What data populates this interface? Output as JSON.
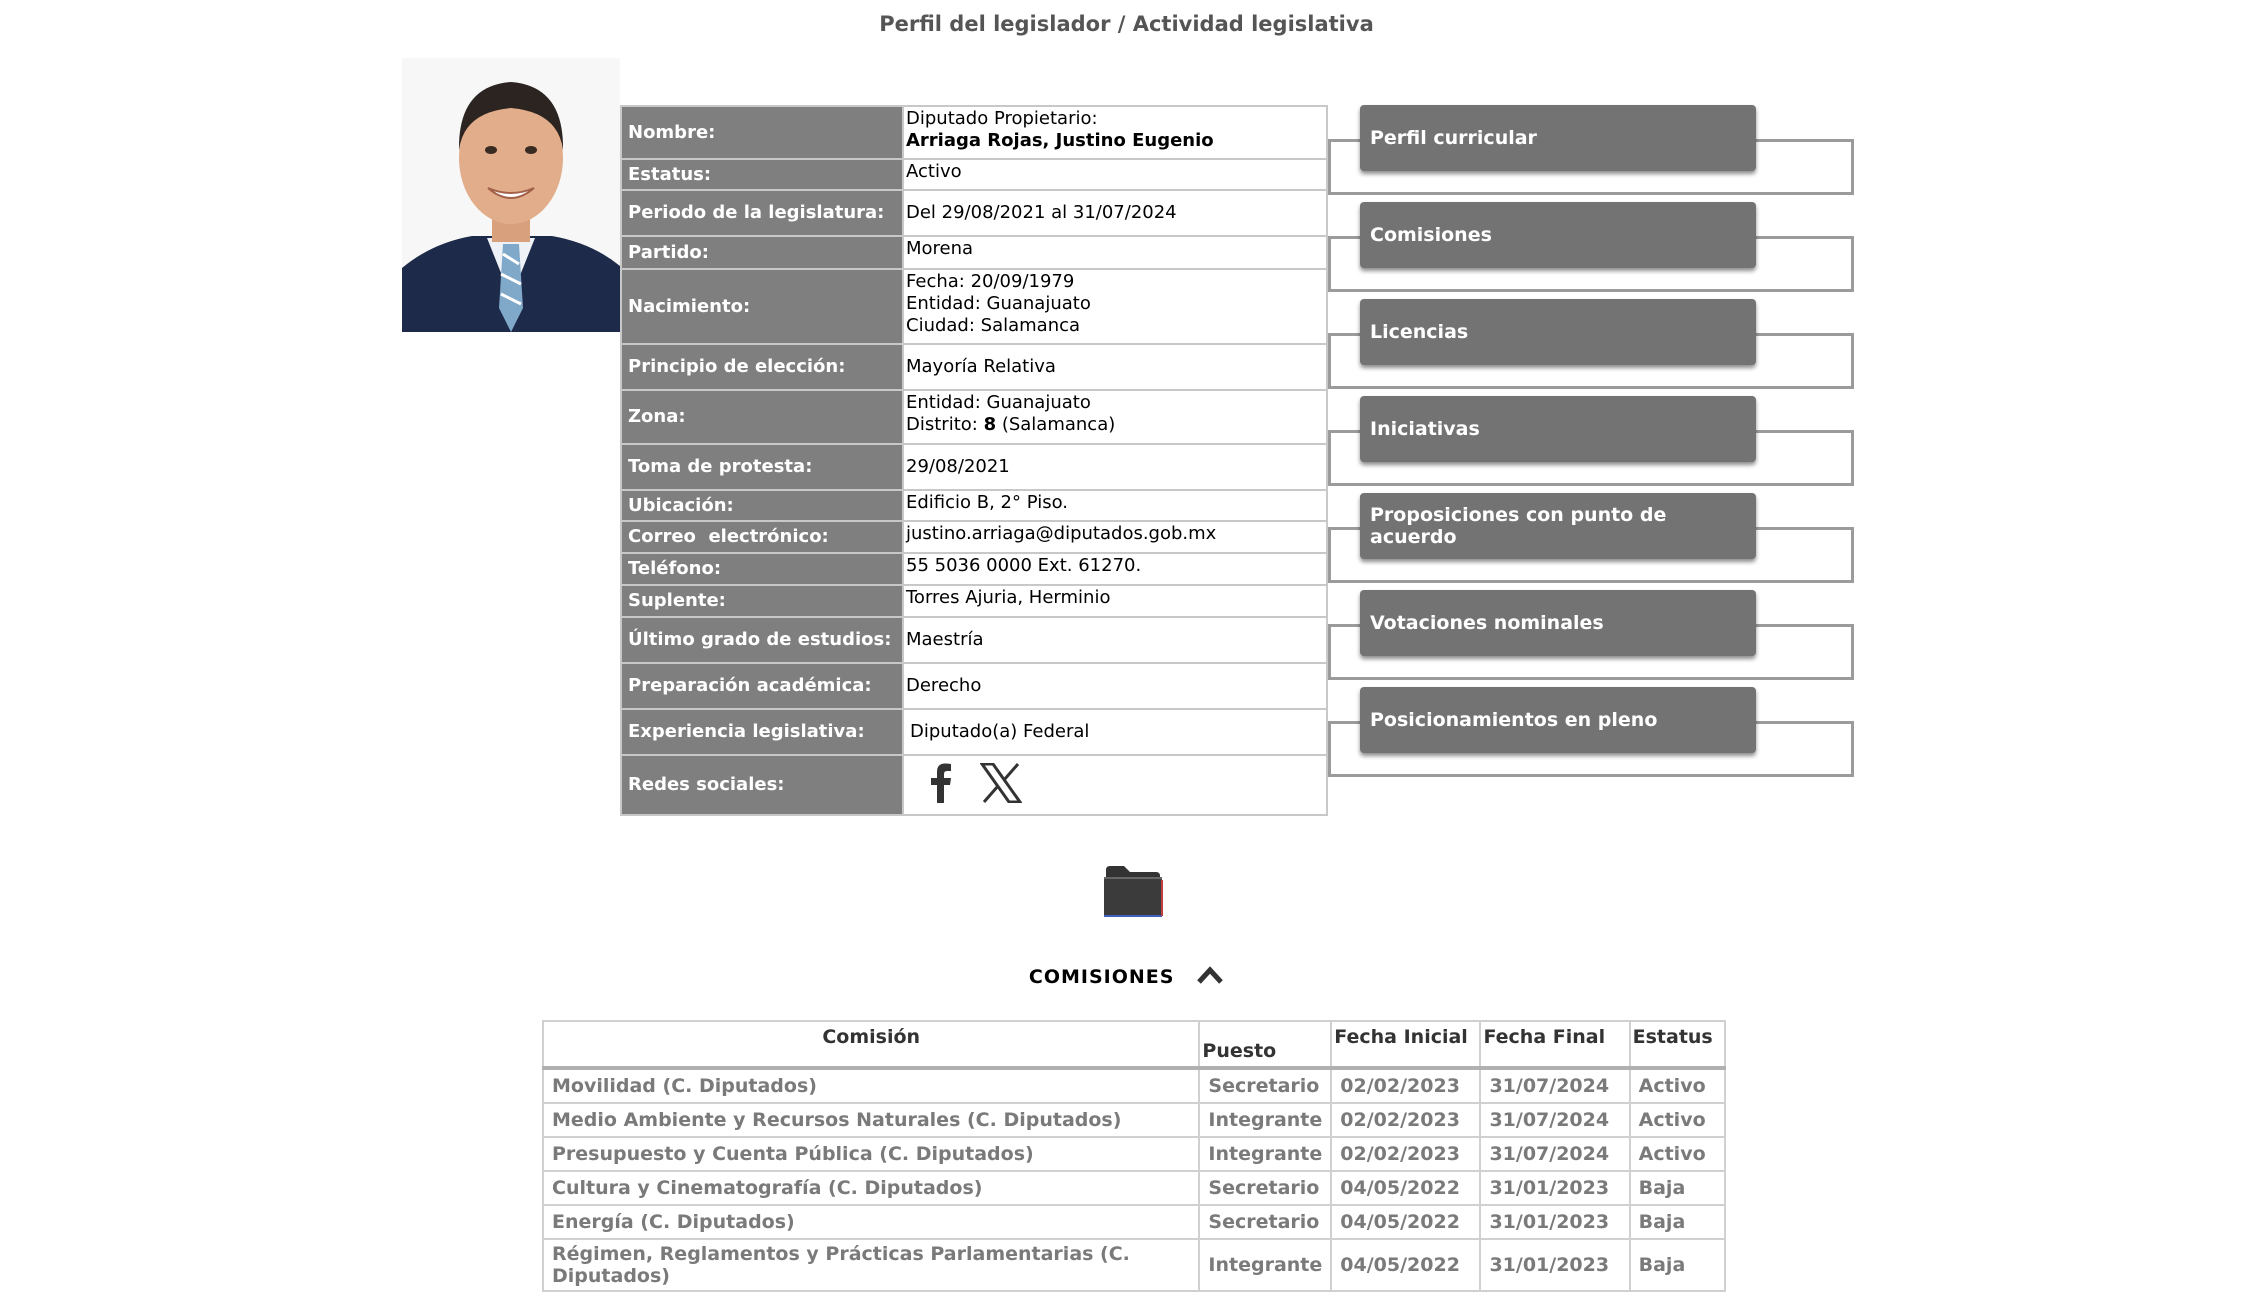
{
  "page": {
    "title": "Perfil del legislador / Actividad legislativa"
  },
  "profile": {
    "rows": [
      {
        "label": "Nombre:",
        "line1": "Diputado Propietario:",
        "line2": "Arriaga Rojas, Justino Eugenio"
      },
      {
        "label": "Estatus:",
        "value": "Activo"
      },
      {
        "label": "Periodo de la legislatura:",
        "value": "Del 29/08/2021 al 31/07/2024"
      },
      {
        "label": "Partido:",
        "value": "Morena"
      },
      {
        "label": "Nacimiento:",
        "line1": "Fecha: 20/09/1979",
        "line2": "Entidad: Guanajuato",
        "line3": "Ciudad: Salamanca"
      },
      {
        "label": "Principio de elección:",
        "value": "Mayoría Relativa"
      },
      {
        "label": "Zona:",
        "line1": "Entidad: Guanajuato",
        "district_prefix": "Distrito: ",
        "district_number": "8",
        "district_suffix": " (Salamanca)"
      },
      {
        "label": "Toma de protesta:",
        "value": "29/08/2021"
      },
      {
        "label": "Ubicación:",
        "value": "Edificio B, 2° Piso."
      },
      {
        "label": "Correo  electrónico:",
        "value": "justino.arriaga@diputados.gob.mx"
      },
      {
        "label": "Teléfono:",
        "value": "55 5036 0000 Ext. 61270."
      },
      {
        "label": "Suplente:",
        "value": "Torres Ajuria, Herminio"
      },
      {
        "label": "Último grado de estudios:",
        "value": "Maestría"
      },
      {
        "label": "Preparación académica:",
        "value": "Derecho"
      },
      {
        "label": "Experiencia legislativa:",
        "value": "Diputado(a) Federal"
      },
      {
        "label": "Redes sociales:",
        "icons": [
          "facebook-icon",
          "x-twitter-icon"
        ]
      }
    ]
  },
  "menu": {
    "items": [
      {
        "label": "Perfil curricular"
      },
      {
        "label": "Comisiones"
      },
      {
        "label": "Licencias"
      },
      {
        "label": "Iniciativas"
      },
      {
        "label": "Proposiciones con punto de acuerdo"
      },
      {
        "label": "Votaciones nominales"
      },
      {
        "label": "Posicionamientos en pleno"
      }
    ]
  },
  "commissions": {
    "heading": "COMISIONES",
    "columns": [
      "Comisión",
      "Puesto",
      "Fecha Inicial",
      "Fecha Final",
      "Estatus"
    ],
    "rows": [
      [
        "Movilidad (C. Diputados)",
        "Secretario",
        "02/02/2023",
        "31/07/2024",
        "Activo"
      ],
      [
        "Medio Ambiente y Recursos Naturales (C. Diputados)",
        "Integrante",
        "02/02/2023",
        "31/07/2024",
        "Activo"
      ],
      [
        "Presupuesto y Cuenta Pública (C. Diputados)",
        "Integrante",
        "02/02/2023",
        "31/07/2024",
        "Activo"
      ],
      [
        "Cultura y Cinematografía (C. Diputados)",
        "Secretario",
        "04/05/2022",
        "31/01/2023",
        "Baja"
      ],
      [
        "Energía (C. Diputados)",
        "Secretario",
        "04/05/2022",
        "31/01/2023",
        "Baja"
      ],
      [
        "Régimen, Reglamentos y Prácticas Parlamentarias (C. Diputados)",
        "Integrante",
        "04/05/2022",
        "31/01/2023",
        "Baja"
      ]
    ]
  },
  "colors": {
    "label_bg": "#7f7f7f",
    "button_bg": "#737373",
    "frame": "#9b9b9b"
  }
}
